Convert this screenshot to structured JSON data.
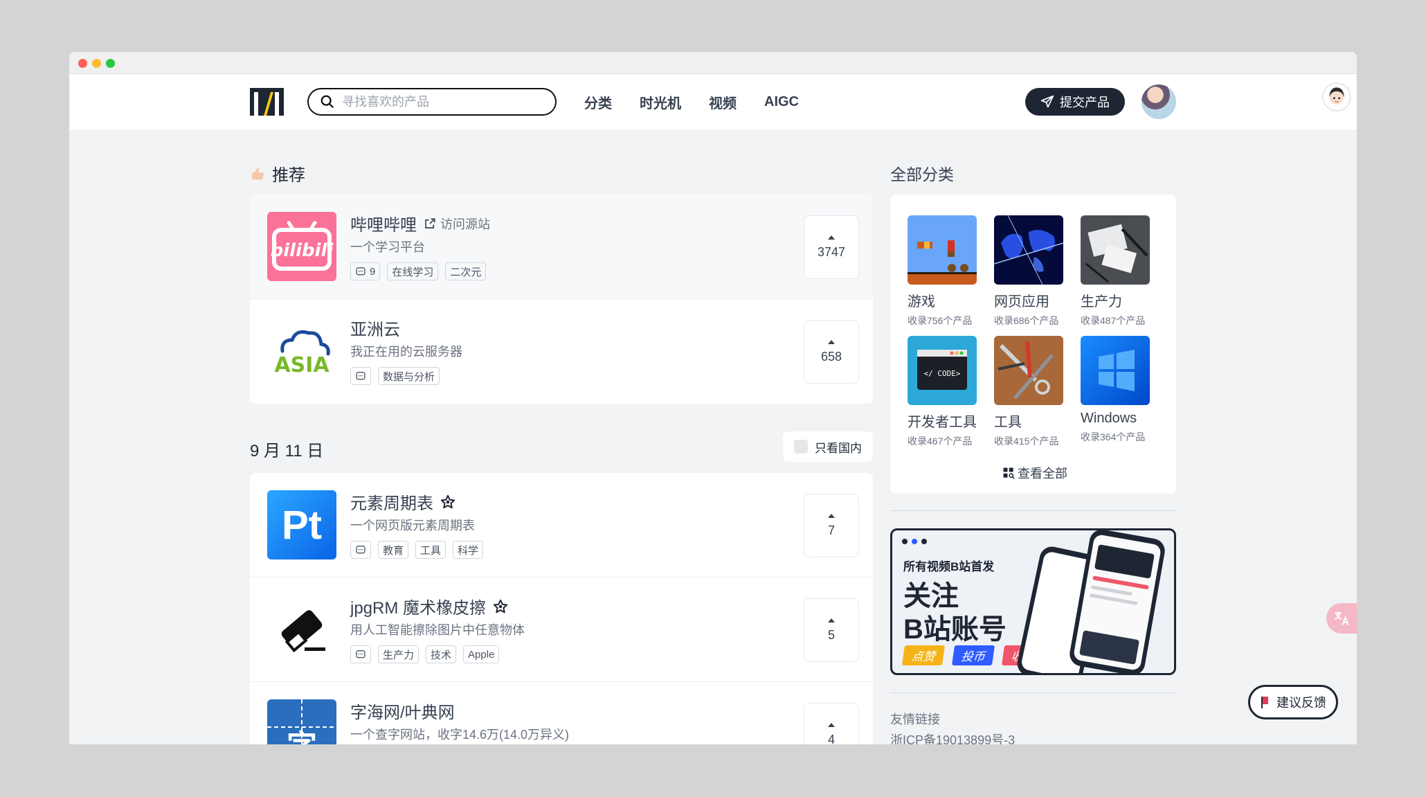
{
  "nav": {
    "search_placeholder": "寻找喜欢的产品",
    "links": [
      "分类",
      "时光机",
      "视频",
      "AIGC"
    ],
    "submit_label": "提交产品"
  },
  "recommend": {
    "title": "推荐",
    "items": [
      {
        "name": "哔哩哔哩",
        "visit": "访问源站",
        "desc": "一个学习平台",
        "comments": "9",
        "tags": [
          "在线学习",
          "二次元"
        ],
        "votes": "3747"
      },
      {
        "name": "亚洲云",
        "desc": "我正在用的云服务器",
        "comments": "",
        "tags": [
          "数据与分析"
        ],
        "votes": "658"
      }
    ]
  },
  "daily": {
    "date": "9 月 11 日",
    "filter_label": "只看国内",
    "items": [
      {
        "name": "元素周期表",
        "desc": "一个网页版元素周期表",
        "comments": "",
        "tags": [
          "教育",
          "工具",
          "科学"
        ],
        "votes": "7"
      },
      {
        "name": "jpgRM 魔术橡皮擦",
        "desc": "用人工智能擦除图片中任意物体",
        "comments": "",
        "tags": [
          "生产力",
          "技术",
          "Apple"
        ],
        "votes": "5"
      },
      {
        "name": "字海网/叶典网",
        "desc": "一个查字网站，收字14.6万(14.0万异义)",
        "votes": "4"
      }
    ]
  },
  "categories": {
    "title": "全部分类",
    "items": [
      {
        "name": "游戏",
        "count": "收录756个产品"
      },
      {
        "name": "网页应用",
        "count": "收录686个产品"
      },
      {
        "name": "生产力",
        "count": "收录487个产品"
      },
      {
        "name": "开发者工具",
        "count": "收录467个产品"
      },
      {
        "name": "工具",
        "count": "收录415个产品"
      },
      {
        "name": "Windows",
        "count": "收录364个产品"
      }
    ],
    "view_all": "查看全部"
  },
  "banner": {
    "line1": "所有视频B站首发",
    "line2": "关注",
    "line3": "B站账号",
    "pills": [
      "点赞",
      "投币",
      "收藏"
    ]
  },
  "footer": {
    "links_label": "友情链接",
    "icp": "浙ICP备19013899号-3"
  },
  "feedback_label": "建议反馈",
  "colors": {
    "accent": "#1e2634",
    "bilibili": "#fb7299",
    "pt_blue": "#1a8cff"
  }
}
